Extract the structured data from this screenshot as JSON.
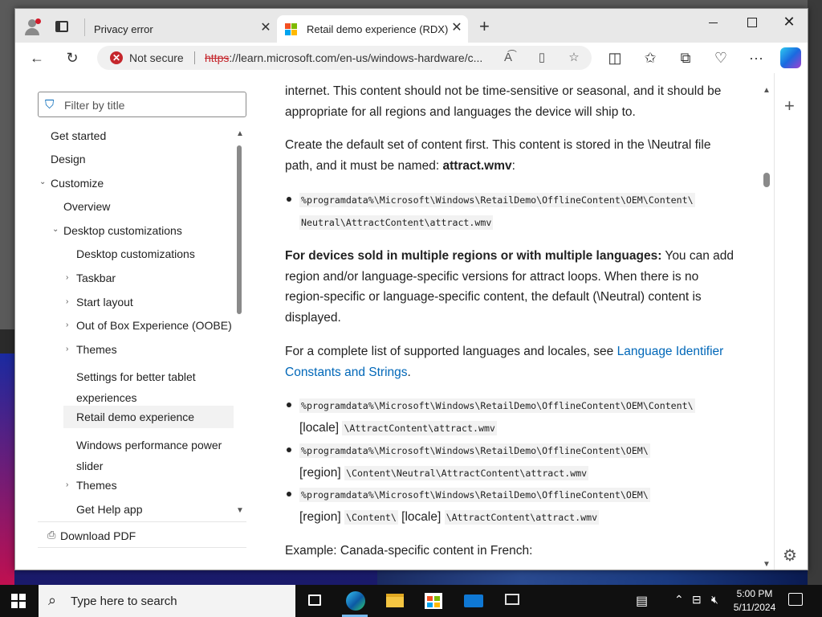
{
  "browser": {
    "tabs": [
      {
        "title": "Privacy error"
      },
      {
        "title": "Retail demo experience (RDX) | Microsoft Learn"
      }
    ],
    "address": {
      "security_label": "Not secure",
      "url_scheme": "https",
      "url_rest": "://learn.microsoft.com/en-us/windows-hardware/c..."
    },
    "colors": {
      "accent": "#0067b8",
      "not_secure": "#c5262c"
    }
  },
  "nav": {
    "filter_placeholder": "Filter by title",
    "items": [
      {
        "label": "Get started",
        "level": 0,
        "chevron": "none"
      },
      {
        "label": "Design",
        "level": 0,
        "chevron": "none"
      },
      {
        "label": "Customize",
        "level": 0,
        "chevron": "down"
      },
      {
        "label": "Overview",
        "level": 1,
        "chevron": "none"
      },
      {
        "label": "Desktop customizations",
        "level": 1,
        "chevron": "down"
      },
      {
        "label": "Desktop customizations",
        "level": 2,
        "chevron": "none"
      },
      {
        "label": "Taskbar",
        "level": 2,
        "chevron": "right"
      },
      {
        "label": "Start layout",
        "level": 2,
        "chevron": "right"
      },
      {
        "label": "Out of Box Experience (OOBE)",
        "level": 2,
        "chevron": "right"
      },
      {
        "label": "Themes",
        "level": 2,
        "chevron": "right"
      },
      {
        "label": "Settings for better tablet",
        "label2": "experiences",
        "level": 2,
        "chevron": "none"
      },
      {
        "label": "Retail demo experience",
        "level": 2,
        "chevron": "none",
        "active": true
      },
      {
        "label": "Windows performance power",
        "label2": "slider",
        "level": 2,
        "chevron": "none"
      },
      {
        "label": "Themes",
        "level": 2,
        "chevron": "right"
      },
      {
        "label": "Get Help app",
        "level": 2,
        "chevron": "none"
      }
    ],
    "download_pdf": "Download PDF"
  },
  "article": {
    "p1_line1": "internet. This content should not be time-sensitive or seasonal, and it should be",
    "p1_line2": "appropriate for all regions and languages the device will ship to.",
    "p2_line1": "Create the default set of content first. This content is stored in the \\Neutral file",
    "p2_line2_pre": "path, and it must be named: ",
    "p2_bold": "attract.wmv",
    "p2_line2_post": ":",
    "code1_line1": "%programdata%\\Microsoft\\Windows\\RetailDemo\\OfflineContent\\OEM\\Content\\",
    "code1_line2": "Neutral\\AttractContent\\attract.wmv",
    "p3_bold": "For devices sold in multiple regions or with multiple languages:",
    "p3_line1_post": " You can add",
    "p3_line2": "region and/or language-specific versions for attract loops. When there is no",
    "p3_line3": "region-specific or language-specific content, the default (\\Neutral) content is",
    "p3_line4": "displayed.",
    "p4_line1_pre": "For a complete list of supported languages and locales, see ",
    "p4_link1": "Language Identifier",
    "p4_link2": "Constants and Strings",
    "p4_post": ".",
    "b1_code_a": "%programdata%\\Microsoft\\Windows\\RetailDemo\\OfflineContent\\OEM\\Content\\",
    "b1_text": "[locale]",
    "b1_code_b": "\\AttractContent\\attract.wmv",
    "b2_code_a": "%programdata%\\Microsoft\\Windows\\RetailDemo\\OfflineContent\\OEM\\",
    "b2_text": "[region]",
    "b2_code_b": "\\Content\\Neutral\\AttractContent\\attract.wmv",
    "b3_code_a": "%programdata%\\Microsoft\\Windows\\RetailDemo\\OfflineContent\\OEM\\",
    "b3_text_a": "[region]",
    "b3_code_b": "\\Content\\",
    "b3_text_b": "[locale]",
    "b3_code_c": "\\AttractContent\\attract.wmv",
    "p5": "Example: Canada-specific content in French:"
  },
  "taskbar": {
    "search_placeholder": "Type here to search",
    "time": "5:00 PM",
    "date": "5/11/2024"
  }
}
